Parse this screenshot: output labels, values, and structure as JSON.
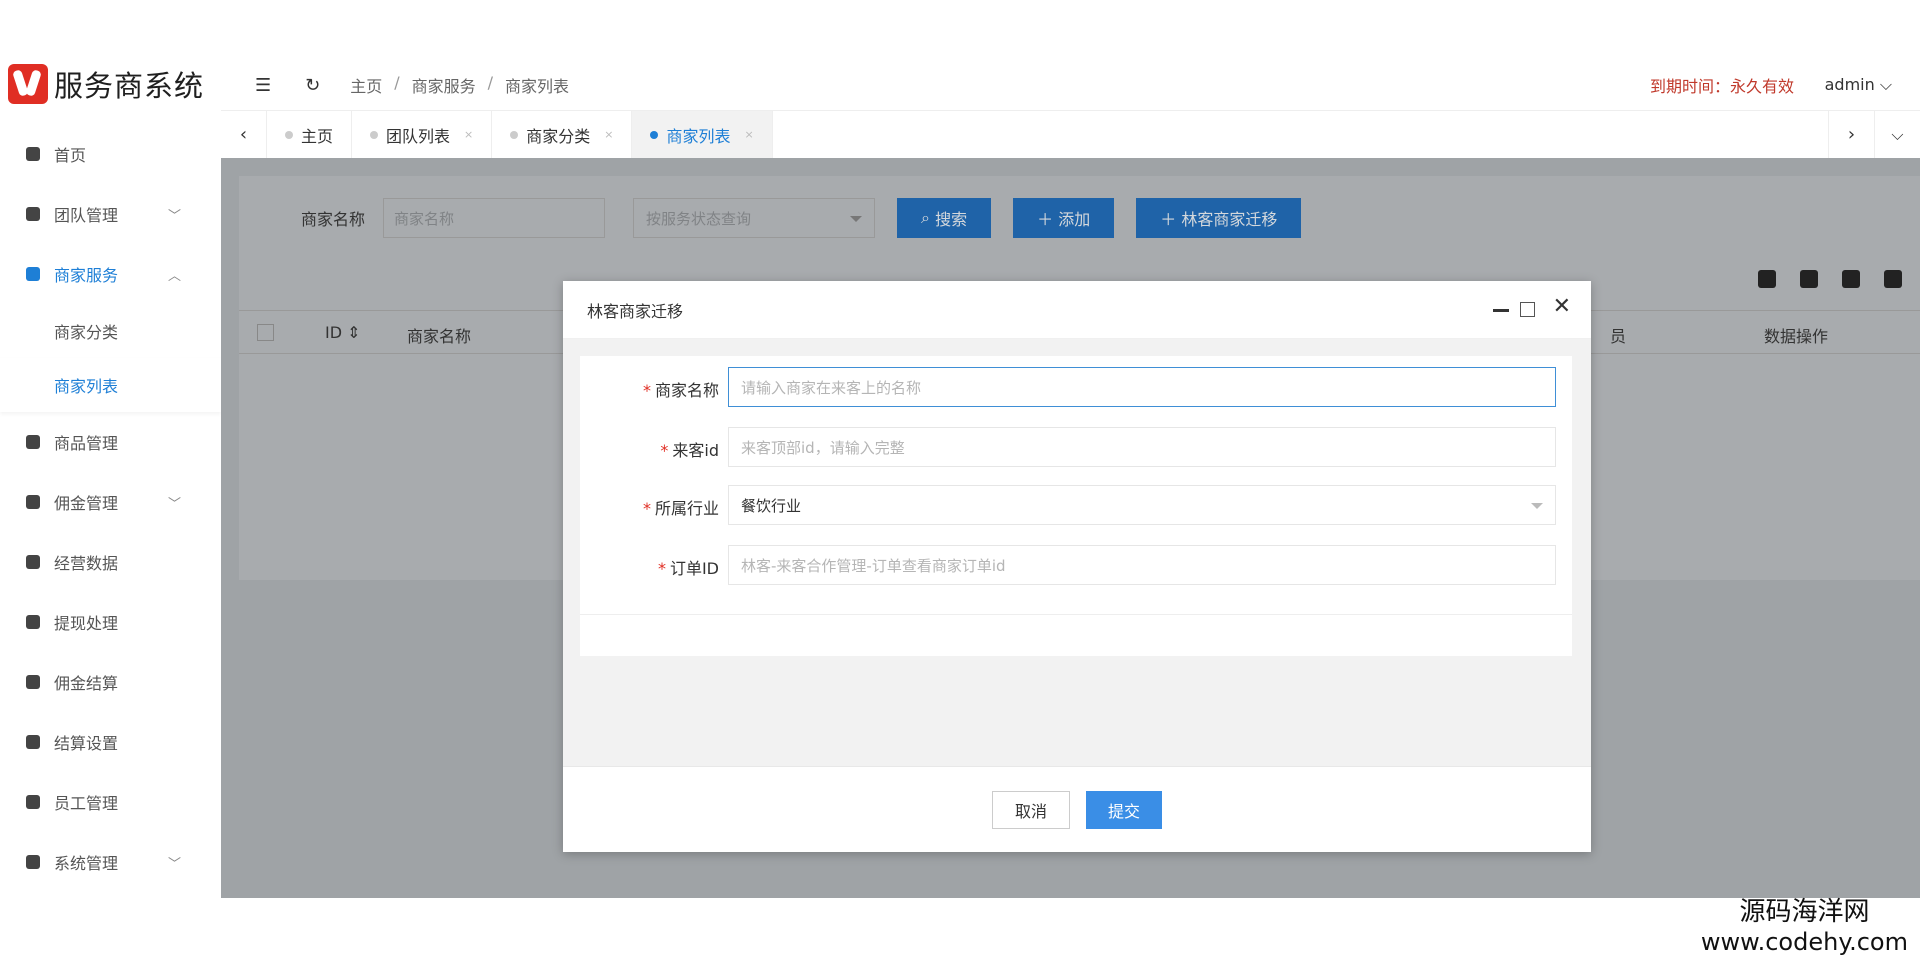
{
  "app": {
    "logo_text": "服务商系统"
  },
  "header": {
    "breadcrumb": [
      "主页",
      "商家服务",
      "商家列表"
    ],
    "expire_label": "到期时间：永久有效",
    "user": "admin"
  },
  "sidebar": {
    "items": [
      {
        "label": "首页"
      },
      {
        "label": "团队管理"
      },
      {
        "label": "商家服务"
      },
      {
        "label": "商品管理"
      },
      {
        "label": "佣金管理"
      },
      {
        "label": "经营数据"
      },
      {
        "label": "提现处理"
      },
      {
        "label": "佣金结算"
      },
      {
        "label": "结算设置"
      },
      {
        "label": "员工管理"
      },
      {
        "label": "系统管理"
      }
    ],
    "sub_items": [
      {
        "label": "商家分类"
      },
      {
        "label": "商家列表"
      }
    ]
  },
  "tabs": [
    {
      "label": "主页"
    },
    {
      "label": "团队列表"
    },
    {
      "label": "商家分类"
    },
    {
      "label": "商家列表"
    }
  ],
  "search": {
    "label": "商家名称",
    "name_placeholder": "商家名称",
    "status_placeholder": "按服务状态查询",
    "search_btn": "搜索",
    "add_btn": "添加",
    "migrate_btn": "林客商家迁移"
  },
  "table": {
    "columns": [
      "ID",
      "商家名称",
      "员",
      "数据操作"
    ]
  },
  "modal": {
    "title": "林客商家迁移",
    "fields": [
      {
        "label": "商家名称",
        "placeholder": "请输入商家在来客上的名称",
        "value": ""
      },
      {
        "label": "来客id",
        "placeholder": "来客顶部id，请输入完整",
        "value": ""
      },
      {
        "label": "所属行业",
        "placeholder": "",
        "value": "餐饮行业"
      },
      {
        "label": "订单ID",
        "placeholder": "林客-来客合作管理-订单查看商家订单id",
        "value": ""
      }
    ],
    "cancel": "取消",
    "submit": "提交"
  },
  "watermark": {
    "name": "源码海洋网",
    "url": "www.codehy.com"
  }
}
